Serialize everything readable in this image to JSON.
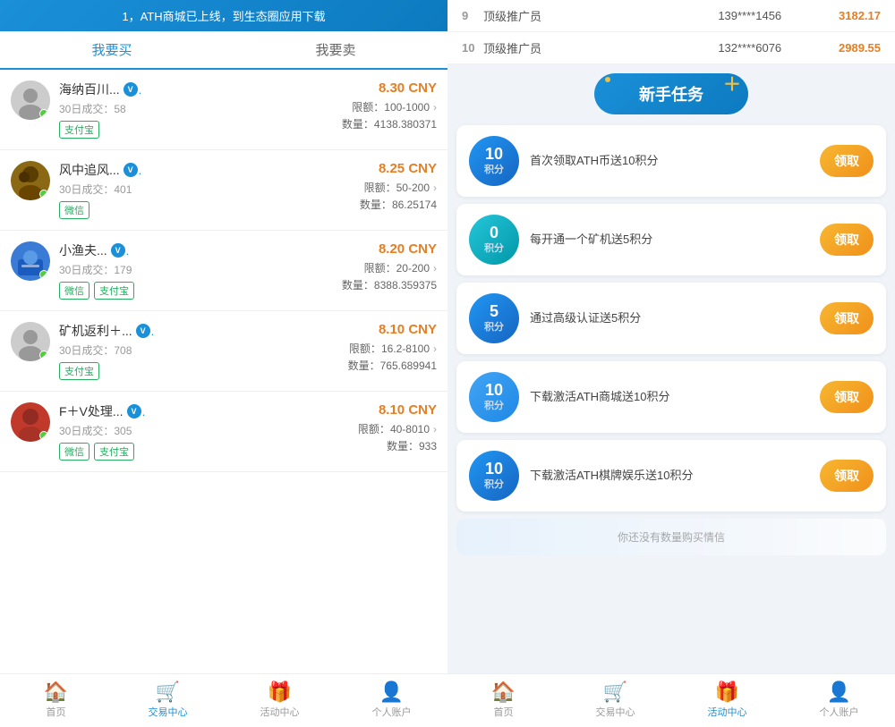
{
  "left": {
    "banner": "1，ATH商城已上线，到生态圈应用下载",
    "tabs": [
      "我要买",
      "我要卖"
    ],
    "active_tab": 0,
    "listings": [
      {
        "name": "海纳百川...",
        "verified": true,
        "trades_30d": 58,
        "price": "8.30 CNY",
        "limit_min": "100",
        "limit_max": "1000",
        "qty": "4138.380371",
        "payments": [
          "支付宝"
        ]
      },
      {
        "name": "风中追风...",
        "verified": true,
        "trades_30d": 401,
        "price": "8.25 CNY",
        "limit_min": "50",
        "limit_max": "200",
        "qty": "86.25174",
        "payments": [
          "微信"
        ]
      },
      {
        "name": "小渔夫...",
        "verified": true,
        "trades_30d": 179,
        "price": "8.20 CNY",
        "limit_min": "20",
        "limit_max": "200",
        "qty": "8388.359375",
        "payments": [
          "微信",
          "支付宝"
        ]
      },
      {
        "name": "矿机返利＋...",
        "verified": true,
        "trades_30d": 708,
        "price": "8.10 CNY",
        "limit_min": "16.2",
        "limit_max": "8100",
        "qty": "765.689941",
        "payments": [
          "支付宝"
        ]
      },
      {
        "name": "F＋V处理...",
        "verified": true,
        "trades_30d": 305,
        "price": "8.10 CNY",
        "limit_min": "40",
        "limit_max": "8010",
        "qty": "933",
        "payments": [
          "微信",
          "支付宝"
        ]
      }
    ],
    "nav": [
      {
        "label": "首页",
        "icon": "🏠",
        "active": false
      },
      {
        "label": "交易中心",
        "icon": "🛒",
        "active": true
      },
      {
        "label": "活动中心",
        "icon": "🎁",
        "active": false
      },
      {
        "label": "个人账户",
        "icon": "👤",
        "active": false
      }
    ]
  },
  "right": {
    "ranking": [
      {
        "rank": "9",
        "title": "顶级推广员",
        "phone": "139****1456",
        "score": "3182.17"
      },
      {
        "rank": "10",
        "title": "顶级推广员",
        "phone": "132****6076",
        "score": "2989.55"
      }
    ],
    "new_task_btn": "新手任务",
    "tasks": [
      {
        "points_num": "10",
        "points_label": "积分",
        "desc": "首次领取ATH币送10积分",
        "btn": "领取",
        "badge_style": "badge-blue"
      },
      {
        "points_num": "0",
        "points_label": "积分",
        "desc": "每开通一个矿机送5积分",
        "btn": "领取",
        "badge_style": "badge-teal"
      },
      {
        "points_num": "5",
        "points_label": "积分",
        "desc": "通过高级认证送5积分",
        "btn": "领取",
        "badge_style": "badge-blue"
      },
      {
        "points_num": "10",
        "points_label": "积分",
        "desc": "下载激活ATH商城送10积分",
        "btn": "领取",
        "badge_style": "badge-light-blue"
      },
      {
        "points_num": "10",
        "points_label": "积分",
        "desc": "下载激活ATH棋牌娱乐送10积分",
        "btn": "领取",
        "badge_style": "badge-blue"
      }
    ],
    "partial_text": "你还没有数量购买情信",
    "nav": [
      {
        "label": "首页",
        "icon": "🏠",
        "active": false
      },
      {
        "label": "交易中心",
        "icon": "🛒",
        "active": false
      },
      {
        "label": "活动中心",
        "icon": "🎁",
        "active": true
      },
      {
        "label": "个人账户",
        "icon": "👤",
        "active": false
      }
    ]
  }
}
